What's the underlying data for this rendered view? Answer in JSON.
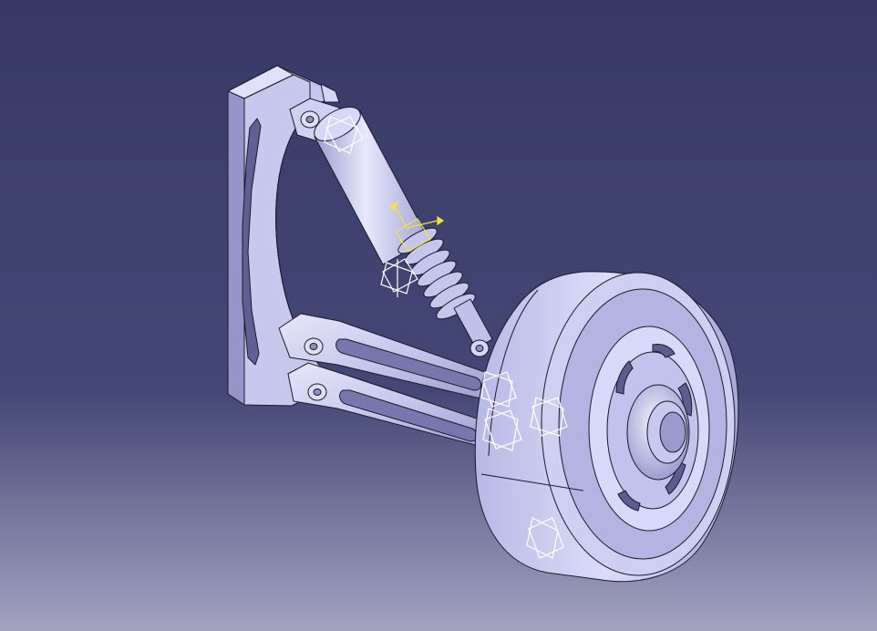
{
  "viewport": {
    "background_top": "#383966",
    "background_mid": "#3f416f",
    "background_bottom": "#9a9ab8"
  },
  "model": {
    "part_face_color": "#c9c9f0",
    "part_shadow_color": "#8e8ec4",
    "part_highlight_color": "#e4e4fb",
    "edge_color": "#1a1a2a",
    "frame_symbol_color": "#ffffff",
    "active_axis_color": "#f2e43a"
  }
}
